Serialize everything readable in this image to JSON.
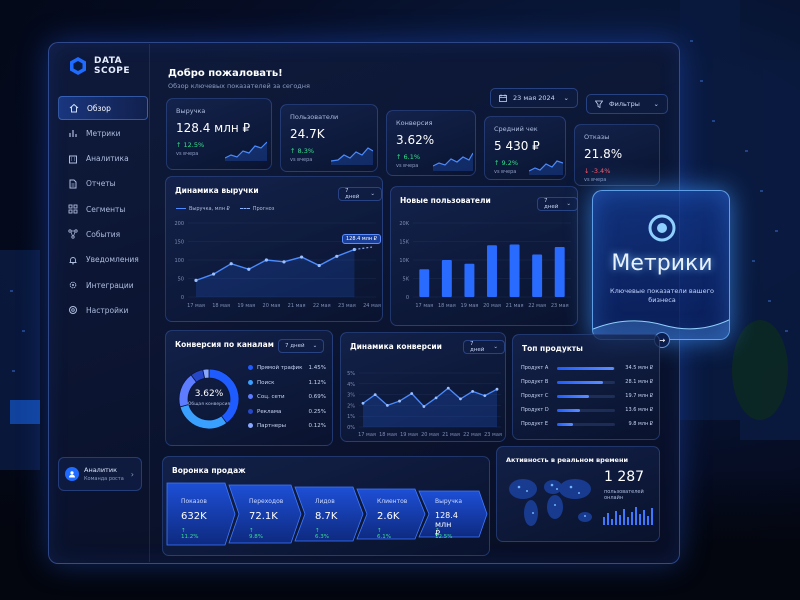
{
  "colors": {
    "accent": "#1f6bff",
    "positive": "#36e08c",
    "negative": "#ff5c6c",
    "glow": "#5ab4ff"
  },
  "brand": {
    "line1": "DATA",
    "line2": "SCOPE"
  },
  "sidebar": {
    "items": [
      {
        "label": "Обзор",
        "icon": "home-icon"
      },
      {
        "label": "Метрики",
        "icon": "bar-chart-icon"
      },
      {
        "label": "Аналитика",
        "icon": "building-icon"
      },
      {
        "label": "Отчеты",
        "icon": "document-icon"
      },
      {
        "label": "Сегменты",
        "icon": "grid-icon"
      },
      {
        "label": "События",
        "icon": "network-icon"
      },
      {
        "label": "Уведомления",
        "icon": "bell-icon"
      },
      {
        "label": "Интеграции",
        "icon": "gear-icon"
      },
      {
        "label": "Настройки",
        "icon": "settings-icon"
      }
    ],
    "user": {
      "name": "Аналитик",
      "role": "Команда роста"
    }
  },
  "header": {
    "title": "Добро пожаловать!",
    "subtitle": "Обзор ключевых показателей за сегодня",
    "date": "23 мая 2024",
    "filters": "Фильтры"
  },
  "kpis": [
    {
      "label": "Выручка",
      "value": "128.4 млн ₽",
      "delta": "↑ 12.5%",
      "trend": "up",
      "note": "vs вчера"
    },
    {
      "label": "Пользователи",
      "value": "24.7K",
      "delta": "↑ 8.3%",
      "trend": "up",
      "note": "vs вчера"
    },
    {
      "label": "Конверсия",
      "value": "3.62%",
      "delta": "↑ 6.1%",
      "trend": "up",
      "note": "vs вчера"
    },
    {
      "label": "Средний чек",
      "value": "5 430 ₽",
      "delta": "↑ 9.2%",
      "trend": "up",
      "note": "vs вчера"
    },
    {
      "label": "Отказы",
      "value": "21.8%",
      "delta": "↓ -3.4%",
      "trend": "down",
      "note": "vs вчера"
    }
  ],
  "revenue": {
    "title": "Динамика выручки",
    "period": "7 дней",
    "legend_actual": "Выручка, млн ₽",
    "legend_forecast": "Прогноз",
    "tooltip": "128.4 млн ₽"
  },
  "new_users": {
    "title": "Новые пользователи",
    "period": "7 дней"
  },
  "conversion_channels": {
    "title": "Конверсия по каналам",
    "period": "7 дней",
    "center_value": "3.62%",
    "center_label": "Общая конверсия",
    "channels": [
      {
        "name": "Прямой трафик",
        "value": "1.45%",
        "color": "#1f5cff"
      },
      {
        "name": "Поиск",
        "value": "1.12%",
        "color": "#3aa0ff"
      },
      {
        "name": "Соц. сети",
        "value": "0.69%",
        "color": "#5e7cff"
      },
      {
        "name": "Реклама",
        "value": "0.25%",
        "color": "#2747c9"
      },
      {
        "name": "Партнеры",
        "value": "0.12%",
        "color": "#8aa8ff"
      }
    ]
  },
  "conversion_dynamics": {
    "title": "Динамика конверсии",
    "period": "7 дней"
  },
  "top_products": {
    "title": "Топ продукты",
    "items": [
      {
        "name": "Продукт A",
        "value": "34.5 млн ₽",
        "share": 0.98
      },
      {
        "name": "Продукт B",
        "value": "28.1 млн ₽",
        "share": 0.8
      },
      {
        "name": "Продукт C",
        "value": "19.7 млн ₽",
        "share": 0.56
      },
      {
        "name": "Продукт D",
        "value": "13.6 млн ₽",
        "share": 0.39
      },
      {
        "name": "Продукт E",
        "value": "9.8 млн ₽",
        "share": 0.28
      }
    ]
  },
  "funnel": {
    "title": "Воронка продаж",
    "stages": [
      {
        "label": "Показов",
        "value": "632K",
        "delta": "↑ 11.2%"
      },
      {
        "label": "Переходов",
        "value": "72.1K",
        "delta": "↑ 9.8%"
      },
      {
        "label": "Лидов",
        "value": "8.7K",
        "delta": "↑ 6.3%"
      },
      {
        "label": "Клиентов",
        "value": "2.6K",
        "delta": "↑ 6.1%"
      },
      {
        "label": "Выручка",
        "value": "128.4 млн ₽",
        "delta": "↑ 12.5%"
      }
    ]
  },
  "realtime": {
    "title": "Активность в реальном времени",
    "value": "1 287",
    "subtitle": "пользователей онлайн"
  },
  "metrics_card": {
    "title": "Метрики",
    "subtitle": "Ключевые показатели вашего бизнеса"
  },
  "chart_data": [
    {
      "type": "line",
      "title": "Динамика выручки",
      "categories": [
        "17 мая",
        "18 мая",
        "19 мая",
        "20 мая",
        "21 мая",
        "22 мая",
        "23 мая",
        "24 мая"
      ],
      "series": [
        {
          "name": "Выручка, млн ₽",
          "values": [
            45,
            62,
            90,
            75,
            100,
            95,
            108,
            85,
            110,
            128.4
          ]
        },
        {
          "name": "Прогноз",
          "values": [
            128.4,
            135
          ]
        }
      ],
      "y_ticks": [
        0,
        50,
        100,
        150,
        200
      ],
      "ylim": [
        0,
        200
      ]
    },
    {
      "type": "bar",
      "title": "Новые пользователи",
      "categories": [
        "17 мая",
        "18 мая",
        "19 мая",
        "20 мая",
        "21 мая",
        "22 мая",
        "23 мая"
      ],
      "values": [
        7.5,
        10,
        9,
        14,
        14.2,
        11.5,
        13.5
      ],
      "y_ticks": [
        "0",
        "5K",
        "10K",
        "15K",
        "20K"
      ],
      "ylim": [
        0,
        20
      ]
    },
    {
      "type": "pie",
      "title": "Конверсия по каналам",
      "categories": [
        "Прямой трафик",
        "Поиск",
        "Соц. сети",
        "Реклама",
        "Партнеры"
      ],
      "values": [
        1.45,
        1.12,
        0.69,
        0.25,
        0.12
      ]
    },
    {
      "type": "area",
      "title": "Динамика конверсии",
      "categories": [
        "17 мая",
        "18 мая",
        "19 мая",
        "20 мая",
        "21 мая",
        "22 мая",
        "23 мая"
      ],
      "values": [
        2.2,
        3.0,
        2.0,
        2.4,
        3.1,
        1.9,
        2.7,
        3.6,
        2.6,
        3.3,
        2.9,
        3.5
      ],
      "y_ticks": [
        "0%",
        "1%",
        "2%",
        "3%",
        "4%",
        "5%"
      ],
      "ylim": [
        0,
        5
      ]
    }
  ]
}
